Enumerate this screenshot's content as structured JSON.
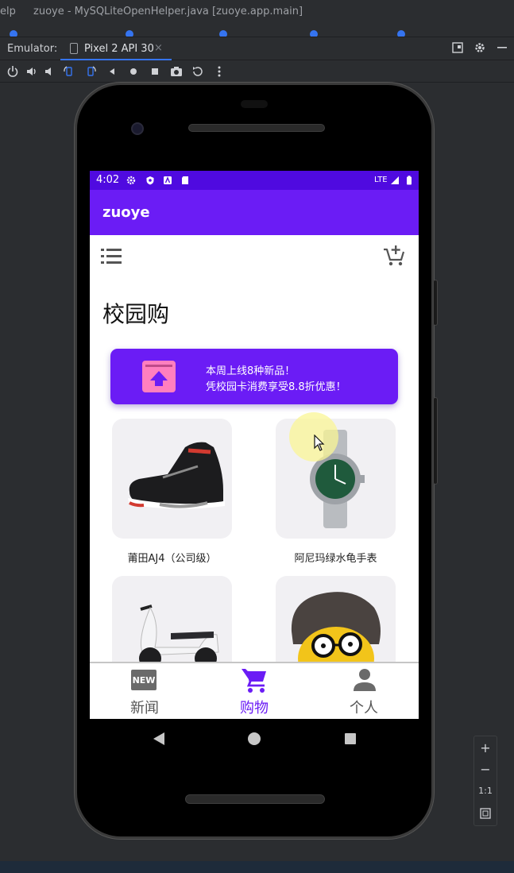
{
  "ide": {
    "menu_fragment": "elp",
    "window_title": "zuoye - MySQLiteOpenHelper.java [zuoye.app.main]",
    "emulator_label": "Emulator:",
    "device_tab": "Pixel 2 API 30",
    "tab_close": "×"
  },
  "device": {
    "status": {
      "time": "4:02",
      "network": "LTE"
    },
    "app_title": "zuoye",
    "page_title": "校园购",
    "promo": {
      "line1": "本周上线8种新品！",
      "line2": "凭校园卡消费享受8.8折优惠！"
    },
    "products": [
      {
        "name": "莆田AJ4（公司级）",
        "image": "sneaker"
      },
      {
        "name": "阿尼玛绿水龟手表",
        "image": "watch"
      },
      {
        "name": "",
        "image": "scooter"
      },
      {
        "name": "",
        "image": "cartoon-face"
      }
    ],
    "bottom_nav": [
      {
        "label": "新闻",
        "icon": "new-badge-icon",
        "active": false
      },
      {
        "label": "购物",
        "icon": "cart-icon",
        "active": true
      },
      {
        "label": "个人",
        "icon": "person-icon",
        "active": false
      }
    ]
  },
  "zoom": {
    "plus": "+",
    "minus": "−",
    "ratio": "1:1"
  },
  "colors": {
    "accent": "#6b1cf5",
    "status_bar": "#4f0ae0",
    "promo_icon": "#ff7fbf"
  }
}
